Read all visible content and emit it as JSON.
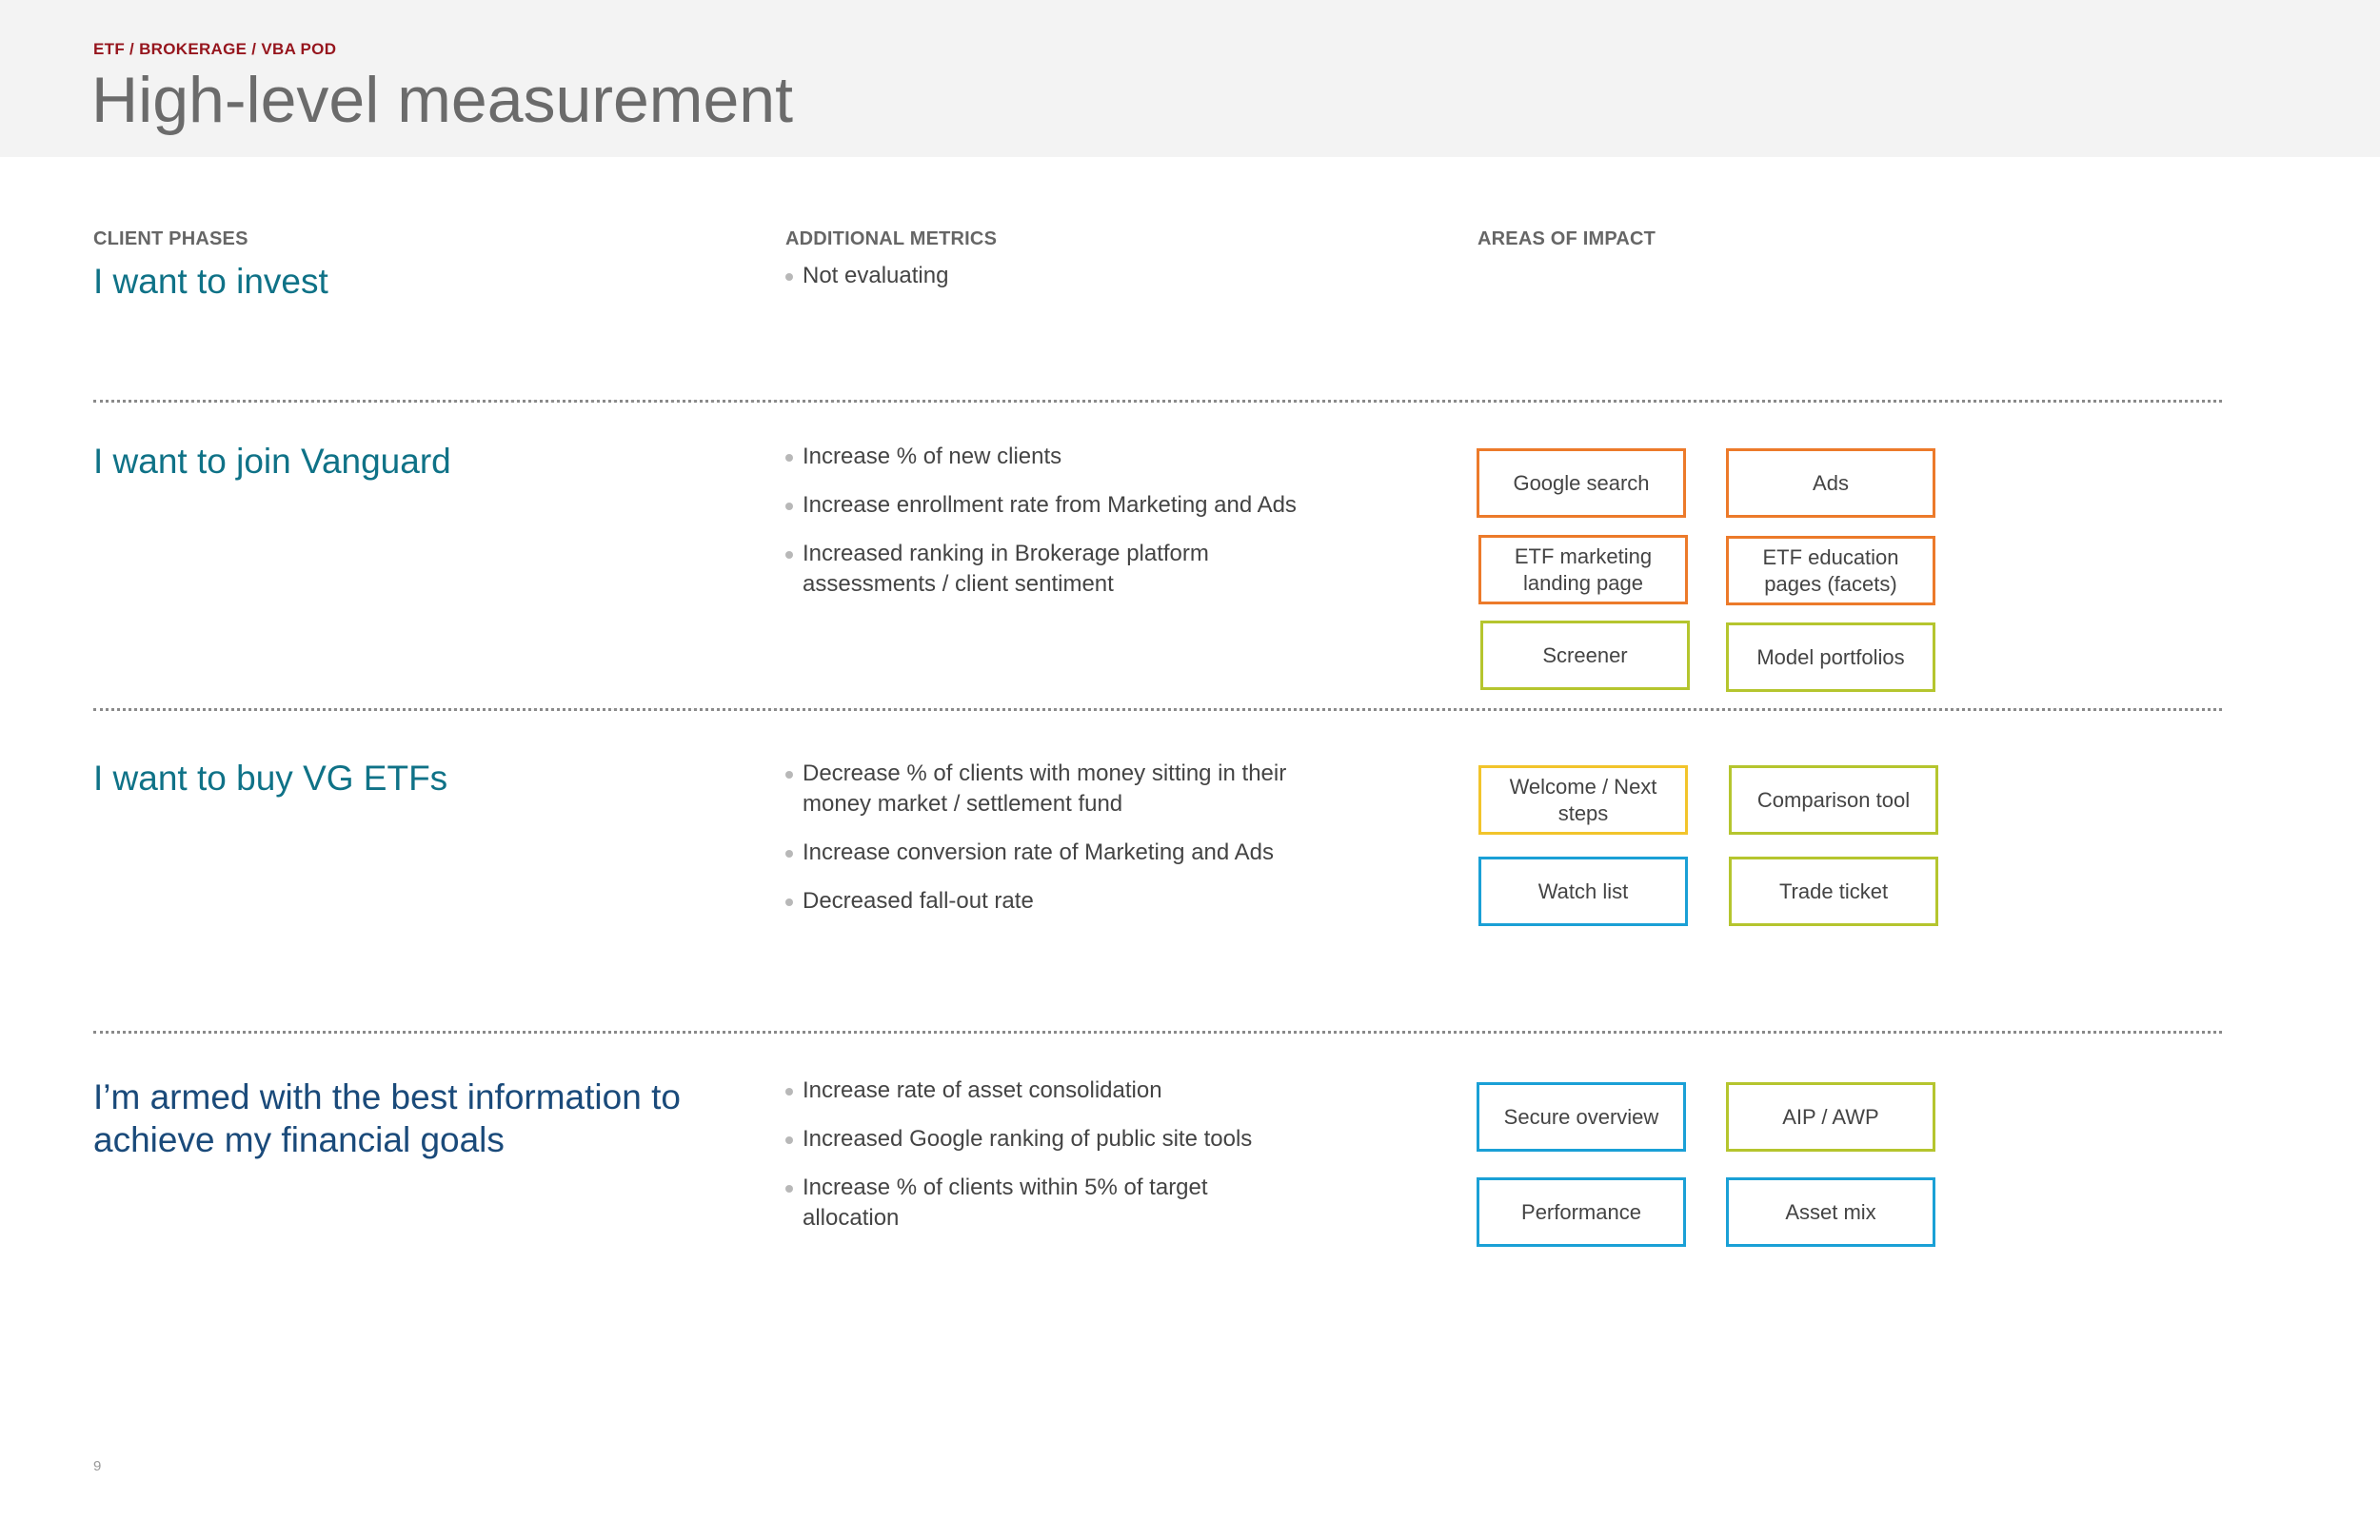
{
  "header": {
    "breadcrumb": "ETF / BROKERAGE / VBA POD",
    "title": "High-level measurement"
  },
  "columns": {
    "phases": "CLIENT PHASES",
    "metrics": "ADDITIONAL METRICS",
    "impact": "AREAS OF IMPACT"
  },
  "rows": [
    {
      "phase": "I want to invest",
      "metrics": [
        "Not evaluating"
      ],
      "impact": []
    },
    {
      "phase": "I want to join Vanguard",
      "metrics": [
        "Increase % of new clients",
        "Increase enrollment rate from Marketing and Ads",
        "Increased ranking in Brokerage platform assessments / client sentiment"
      ],
      "impact": [
        {
          "label": "Google search",
          "color": "#ec7a2a"
        },
        {
          "label": "Ads",
          "color": "#ec7a2a"
        },
        {
          "label": "ETF marketing landing page",
          "color": "#ec7a2a"
        },
        {
          "label": "ETF education pages (facets)",
          "color": "#ec7a2a"
        },
        {
          "label": "Screener",
          "color": "#b5c52e"
        },
        {
          "label": "Model portfolios",
          "color": "#b5c52e"
        }
      ]
    },
    {
      "phase": "I want to buy VG ETFs",
      "metrics": [
        "Decrease % of clients with money sitting in their money market / settlement fund",
        "Increase conversion rate of Marketing and Ads",
        "Decreased fall-out rate"
      ],
      "impact": [
        {
          "label": "Welcome / Next steps",
          "color": "#f2c42b"
        },
        {
          "label": "Comparison tool",
          "color": "#b5c52e"
        },
        {
          "label": "Watch list",
          "color": "#1aa0d6"
        },
        {
          "label": "Trade ticket",
          "color": "#b5c52e"
        }
      ]
    },
    {
      "phase": "I’m armed with the best information to achieve my financial goals",
      "metrics": [
        "Increase rate of asset consolidation",
        "Increased Google ranking of public site tools",
        "Increase % of clients within 5% of target allocation"
      ],
      "impact": [
        {
          "label": "Secure overview",
          "color": "#1aa0d6"
        },
        {
          "label": "AIP / AWP",
          "color": "#b5c52e"
        },
        {
          "label": "Performance",
          "color": "#1aa0d6"
        },
        {
          "label": "Asset mix",
          "color": "#1aa0d6"
        }
      ]
    }
  ],
  "footer": {
    "page_number": "9"
  }
}
